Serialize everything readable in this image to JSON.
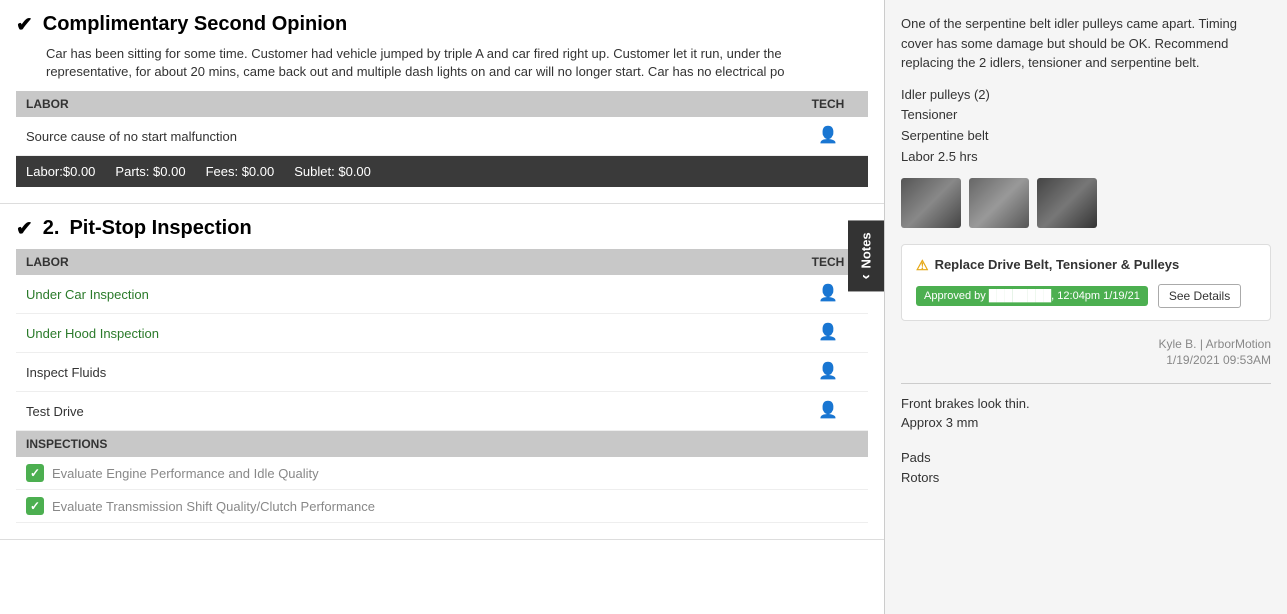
{
  "left": {
    "section1": {
      "checkmark": "✔",
      "title": "Complimentary Second Opinion",
      "description": "Car has been sitting for some time. Customer had vehicle jumped by triple A and car fired right up. Customer let it run, under the representative, for about 20 mins, came back out and multiple dash lights on and car will no longer start. Car has no electrical po",
      "labor_header": "LABOR",
      "tech_header": "TECH",
      "labor_items": [
        {
          "label": "Source cause of no start malfunction"
        }
      ],
      "totals": {
        "labor_label": "Labor:",
        "labor_value": "$0.00",
        "parts_label": "Parts:",
        "parts_value": "$0.00",
        "fees_label": "Fees:",
        "fees_value": "$0.00",
        "sublet_label": "Sublet:",
        "sublet_value": "$0.00"
      }
    },
    "section2": {
      "checkmark": "✔",
      "number": "2.",
      "title": "Pit-Stop Inspection",
      "labor_header": "LABOR",
      "tech_header": "TECH",
      "labor_items": [
        {
          "label": "Under Car Inspection",
          "green": true
        },
        {
          "label": "Under Hood Inspection",
          "green": true
        },
        {
          "label": "Inspect Fluids",
          "green": false
        },
        {
          "label": "Test Drive",
          "green": false
        }
      ],
      "inspections_header": "INSPECTIONS",
      "inspection_items": [
        {
          "checked": true,
          "label": "Evaluate Engine Performance and Idle Quality"
        },
        {
          "checked": true,
          "label": "Evaluate Transmission Shift Quality/Clutch Performance"
        }
      ]
    },
    "notes_tab": "Notes"
  },
  "right": {
    "description": "One of the serpentine belt idler pulleys came apart. Timing cover has some damage but should be OK. Recommend replacing the 2 idlers, tensioner and serpentine belt.",
    "parts_list": [
      "Idler pulleys (2)",
      "Tensioner",
      "Serpentine belt",
      "Labor 2.5 hrs"
    ],
    "alert": {
      "warning_icon": "⚠",
      "title": "Replace Drive Belt, Tensioner & Pulleys",
      "approved_text": "Approved by ████████, 12:04pm 1/19/21",
      "see_details_label": "See Details"
    },
    "author": "Kyle B. | ArborMotion",
    "timestamp": "1/19/2021 09:53AM",
    "description2_line1": "Front brakes look thin.",
    "description2_line2": "Approx 3 mm",
    "parts_list2_header": "",
    "parts_list2": [
      "Pads",
      "Rotors"
    ]
  }
}
